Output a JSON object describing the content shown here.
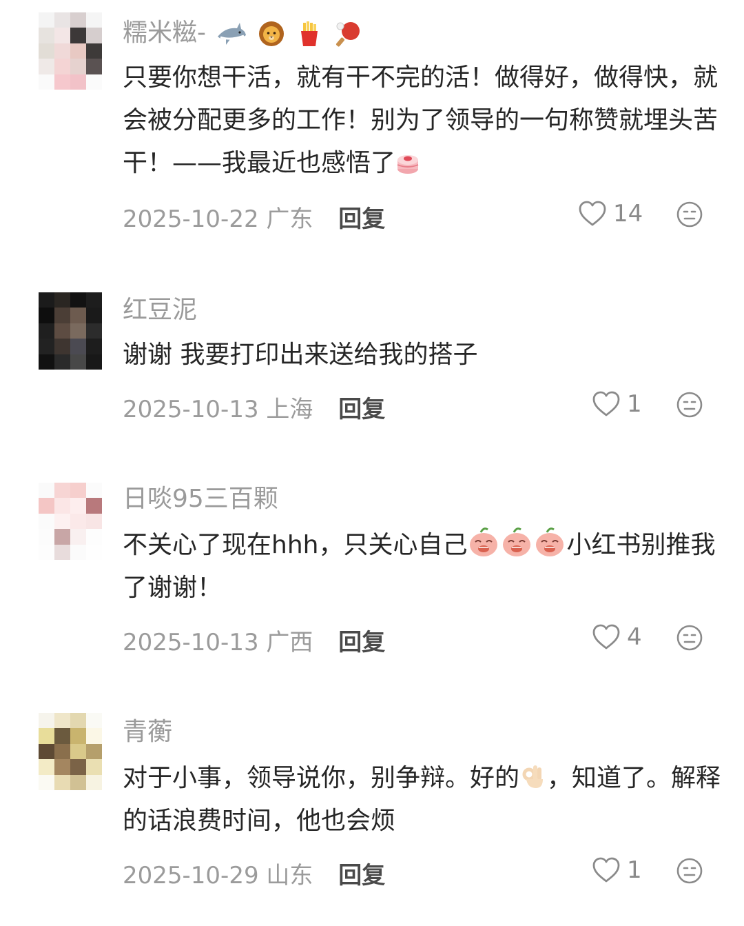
{
  "comments": [
    {
      "username": "糯米糍-",
      "username_emojis": [
        "shark-emoji",
        "lion-emoji",
        "fries-emoji",
        "ping-pong-emoji"
      ],
      "text_parts": [
        "只要你想干活，就有干不完的活！做得好，做得快，就会被分配更多的工作！别为了领导的一句称赞就埋头苦干！——我最近也感悟了"
      ],
      "date": "2025-10-22",
      "location": "广东",
      "reply_label": "回复",
      "likes": "14"
    },
    {
      "username": "红豆泥",
      "text_parts": [
        "谢谢 我要打印出来送给我的搭子"
      ],
      "date": "2025-10-13",
      "location": "上海",
      "reply_label": "回复",
      "likes": "1"
    },
    {
      "username": "日啖95三百颗",
      "text_parts": [
        "不关心了现在hhh，只关心自己",
        "小红书别推我了谢谢！"
      ],
      "date": "2025-10-13",
      "location": "广西",
      "reply_label": "回复",
      "likes": "4"
    },
    {
      "username": "青蘅",
      "text_parts": [
        "对于小事，领导说你，别争辩。好的",
        "，知道了。解释的话浪费时间，他也会烦"
      ],
      "date": "2025-10-29",
      "location": "山东",
      "reply_label": "回复",
      "likes": "1"
    }
  ],
  "icons": {
    "like": "heart-outline-icon",
    "dislike": "neutral-face-icon"
  },
  "colors": {
    "username": "#9a9a9a",
    "body_text": "#262626",
    "meta": "#9b9b9b"
  }
}
